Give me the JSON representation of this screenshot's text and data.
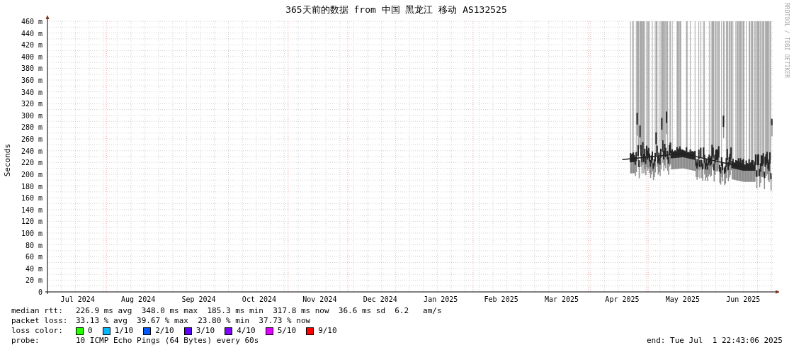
{
  "title": "365天前的数据 from 中国 黑龙江 移动 AS132525",
  "watermark": "RRDTOOL / TOBI OETIKER",
  "chart_data": {
    "type": "line",
    "grid": true,
    "ylabel": "Seconds",
    "ylim": [
      0,
      460
    ],
    "categories": [
      "Jul 2024",
      "Aug 2024",
      "Sep 2024",
      "Oct 2024",
      "Nov 2024",
      "Dec 2024",
      "Jan 2025",
      "Feb 2025",
      "Mar 2025",
      "Apr 2025",
      "May 2025",
      "Jun 2025"
    ],
    "yticks": [
      {
        "value": 0,
        "label": "0"
      },
      {
        "value": 20,
        "label": "20 m"
      },
      {
        "value": 40,
        "label": "40 m"
      },
      {
        "value": 60,
        "label": "60 m"
      },
      {
        "value": 80,
        "label": "80 m"
      },
      {
        "value": 100,
        "label": "100 m"
      },
      {
        "value": 120,
        "label": "120 m"
      },
      {
        "value": 140,
        "label": "140 m"
      },
      {
        "value": 160,
        "label": "160 m"
      },
      {
        "value": 180,
        "label": "180 m"
      },
      {
        "value": 200,
        "label": "200 m"
      },
      {
        "value": 220,
        "label": "220 m"
      },
      {
        "value": 240,
        "label": "240 m"
      },
      {
        "value": 260,
        "label": "260 m"
      },
      {
        "value": 280,
        "label": "280 m"
      },
      {
        "value": 300,
        "label": "300 m"
      },
      {
        "value": 320,
        "label": "320 m"
      },
      {
        "value": 340,
        "label": "340 m"
      },
      {
        "value": 360,
        "label": "360 m"
      },
      {
        "value": 380,
        "label": "380 m"
      },
      {
        "value": 400,
        "label": "400 m"
      },
      {
        "value": 420,
        "label": "420 m"
      },
      {
        "value": 440,
        "label": "440 m"
      },
      {
        "value": 460,
        "label": "460 m"
      }
    ],
    "series": [
      {
        "color": "#202020",
        "values": [
          null,
          null,
          null,
          null,
          null,
          null,
          null,
          null,
          null,
          225,
          235,
          212
        ]
      }
    ]
  },
  "stats": [
    {
      "label": "median rtt:",
      "text": "226.9 ms avg  348.0 ms max  185.3 ms min  317.8 ms now  36.6 ms sd  6.2   am/s"
    },
    {
      "label": "packet loss:",
      "text": "33.13 % avg  39.67 % max  23.80 % min  37.73 % now"
    }
  ],
  "loss_color": {
    "label": "loss color:",
    "items": [
      {
        "label": "0",
        "color": "#26ff00"
      },
      {
        "label": "1/10",
        "color": "#00b8ff"
      },
      {
        "label": "2/10",
        "color": "#0059ff"
      },
      {
        "label": "3/10",
        "color": "#5e00ff"
      },
      {
        "label": "4/10",
        "color": "#7e00ff"
      },
      {
        "label": "5/10",
        "color": "#dd00ff"
      },
      {
        "label": "9/10",
        "color": "#ff0000"
      }
    ]
  },
  "probe": {
    "label": "probe:",
    "text": "10 ICMP Echo Pings (64 Bytes) every 60s"
  },
  "end": "end: Tue Jul  1 22:43:06 2025"
}
